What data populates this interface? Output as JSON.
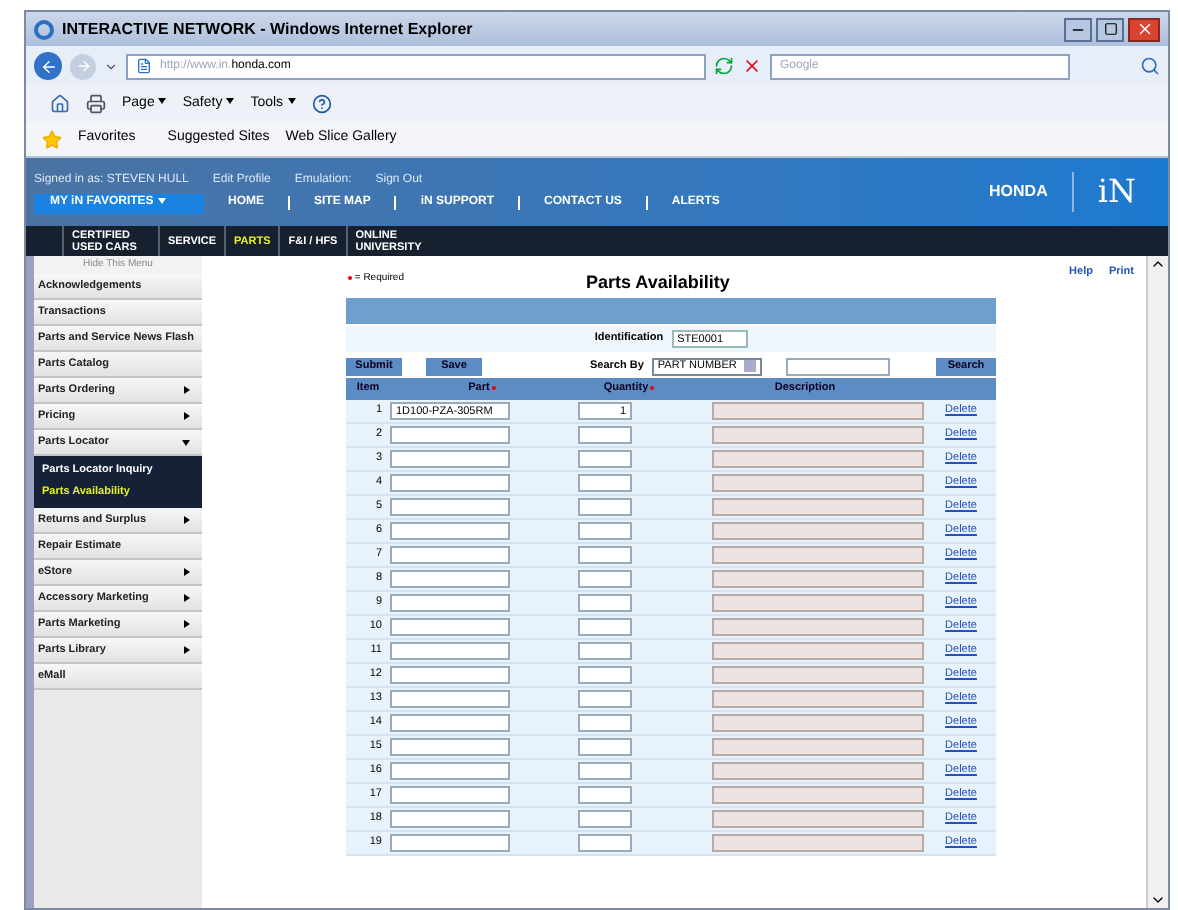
{
  "browser": {
    "title": "INTERACTIVE NETWORK - Windows Internet Explorer",
    "url_prefix": "http://www.in.",
    "url_domain": "honda.com",
    "search_placeholder": "Google",
    "commands": [
      "Page",
      "Safety",
      "Tools"
    ],
    "favorites": "Favorites",
    "favorite_links": [
      "Suggested Sites",
      "Web Slice Gallery"
    ]
  },
  "header": {
    "signed_in": "Signed in as: STEVEN HULL",
    "links": [
      "Edit Profile",
      "Emulation:",
      "Sign Out"
    ],
    "favorites_button": "MY iN FAVORITES",
    "nav": [
      "HOME",
      "SITE MAP",
      "iN SUPPORT",
      "CONTACT US",
      "ALERTS"
    ],
    "brand": "HONDA",
    "logo": "iN"
  },
  "tabs": [
    {
      "label": "CERTIFIED USED CARS",
      "selected": false
    },
    {
      "label": "SERVICE",
      "selected": false
    },
    {
      "label": "PARTS",
      "selected": true
    },
    {
      "label": "F&I / HFS",
      "selected": false
    },
    {
      "label": "ONLINE UNIVERSITY",
      "selected": false
    }
  ],
  "sidebar": {
    "hide_menu": "Hide This Menu",
    "items": [
      {
        "label": "Acknowledgements",
        "has_submenu": false
      },
      {
        "label": "Transactions",
        "has_submenu": false
      },
      {
        "label": "Parts and Service News Flash",
        "has_submenu": false
      },
      {
        "label": "Parts Catalog",
        "has_submenu": false
      },
      {
        "label": "Parts Ordering",
        "has_submenu": true,
        "expanded": false
      },
      {
        "label": "Pricing",
        "has_submenu": true,
        "expanded": false
      },
      {
        "label": "Parts Locator",
        "has_submenu": true,
        "expanded": true,
        "children": [
          {
            "label": "Parts Locator Inquiry",
            "selected": false
          },
          {
            "label": "Parts Availability",
            "selected": true
          }
        ]
      },
      {
        "label": "Returns and Surplus",
        "has_submenu": true,
        "expanded": false
      },
      {
        "label": "Repair Estimate",
        "has_submenu": false
      },
      {
        "label": "eStore",
        "has_submenu": true,
        "expanded": false
      },
      {
        "label": "Accessory Marketing",
        "has_submenu": true,
        "expanded": false
      },
      {
        "label": "Parts Marketing",
        "has_submenu": true,
        "expanded": false
      },
      {
        "label": "Parts Library",
        "has_submenu": true,
        "expanded": false
      },
      {
        "label": "eMall",
        "has_submenu": false
      }
    ]
  },
  "main": {
    "required_note": "= Required",
    "help": "Help",
    "print": "Print",
    "title": "Parts Availability",
    "identification_label": "Identification",
    "identification_value": "STE0001",
    "submit": "Submit",
    "save": "Save",
    "search_by_label": "Search By",
    "search_by_value": "PART NUMBER",
    "search_button": "Search",
    "columns": [
      {
        "label": "Item",
        "required": false
      },
      {
        "label": "Part",
        "required": true
      },
      {
        "label": "Quantity",
        "required": true
      },
      {
        "label": "Description",
        "required": false
      }
    ],
    "rows": [
      {
        "item": "1",
        "part": "1D100-PZA-305RM",
        "quantity": "1",
        "action": "Delete"
      },
      {
        "item": "2",
        "action": "Delete"
      },
      {
        "item": "3",
        "action": "Delete"
      },
      {
        "item": "4",
        "action": "Delete"
      },
      {
        "item": "5",
        "action": "Delete"
      },
      {
        "item": "6",
        "action": "Delete"
      },
      {
        "item": "7",
        "action": "Delete"
      },
      {
        "item": "8",
        "action": "Delete"
      },
      {
        "item": "9",
        "action": "Delete"
      },
      {
        "item": "10",
        "action": "Delete"
      },
      {
        "item": "11",
        "action": "Delete"
      },
      {
        "item": "12",
        "action": "Delete"
      },
      {
        "item": "13",
        "action": "Delete"
      },
      {
        "item": "14",
        "action": "Delete"
      },
      {
        "item": "15",
        "action": "Delete"
      },
      {
        "item": "16",
        "action": "Delete"
      },
      {
        "item": "17",
        "action": "Delete"
      },
      {
        "item": "18",
        "action": "Delete"
      },
      {
        "item": "19",
        "action": "Delete"
      }
    ]
  }
}
